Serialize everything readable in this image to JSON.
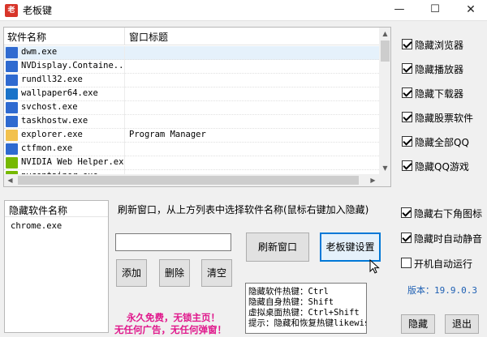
{
  "window": {
    "title": "老板键",
    "minimize": "—",
    "maximize": "☐",
    "close": "✕"
  },
  "process_list": {
    "columns": [
      "软件名称",
      "窗口标题"
    ],
    "rows": [
      {
        "name": "dwm.exe",
        "title": "",
        "icon": "window-icon",
        "color": "#2f6ad0",
        "selected": true
      },
      {
        "name": "NVDisplay.Containe...",
        "title": "",
        "icon": "window-icon",
        "color": "#2f6ad0"
      },
      {
        "name": "rundll32.exe",
        "title": "",
        "icon": "window-icon",
        "color": "#2f6ad0"
      },
      {
        "name": "wallpaper64.exe",
        "title": "",
        "icon": "wallpaper-engine-icon",
        "color": "#1a73c9"
      },
      {
        "name": "svchost.exe",
        "title": "",
        "icon": "window-icon",
        "color": "#2f6ad0"
      },
      {
        "name": "taskhostw.exe",
        "title": "",
        "icon": "window-icon",
        "color": "#2f6ad0"
      },
      {
        "name": "explorer.exe",
        "title": "Program Manager",
        "icon": "folder-icon",
        "color": "#f2c14e"
      },
      {
        "name": "ctfmon.exe",
        "title": "",
        "icon": "window-icon",
        "color": "#2f6ad0"
      },
      {
        "name": "NVIDIA Web Helper.exe",
        "title": "",
        "icon": "nvidia-icon",
        "color": "#76b900"
      },
      {
        "name": "nvcontainer.exe",
        "title": "",
        "icon": "nvidia-icon",
        "color": "#76b900"
      }
    ]
  },
  "options_top": [
    {
      "label": "隐藏浏览器",
      "checked": true
    },
    {
      "label": "隐藏播放器",
      "checked": true
    },
    {
      "label": "隐藏下载器",
      "checked": true
    },
    {
      "label": "隐藏股票软件",
      "checked": true
    },
    {
      "label": "隐藏全部QQ",
      "checked": true
    },
    {
      "label": "隐藏QQ游戏",
      "checked": true
    }
  ],
  "options_bottom": [
    {
      "label": "隐藏右下角图标",
      "checked": true
    },
    {
      "label": "隐藏时自动静音",
      "checked": true
    },
    {
      "label": "开机自动运行",
      "checked": false
    }
  ],
  "hidden_list": {
    "header": "隐藏软件名称",
    "items": [
      "chrome.exe"
    ]
  },
  "hint": "刷新窗口，从上方列表中选择软件名称(鼠标右键加入隐藏)",
  "search": {
    "value": ""
  },
  "buttons": {
    "add": "添加",
    "delete": "删除",
    "clear": "清空",
    "refresh": "刷新窗口",
    "settings": "老板键设置",
    "hide": "隐藏",
    "exit": "退出"
  },
  "hotkeys": [
    "隐藏软件热键：Ctrl",
    "隐藏自身热键：Shift",
    "虚拟桌面热键：Ctrl+Shift",
    "提示：隐藏和恢复热键likewise"
  ],
  "version": "版本：19.9.0.3",
  "promo": [
    "永久免费，无锁主页！",
    "无任何广告，无任何弹窗！"
  ]
}
